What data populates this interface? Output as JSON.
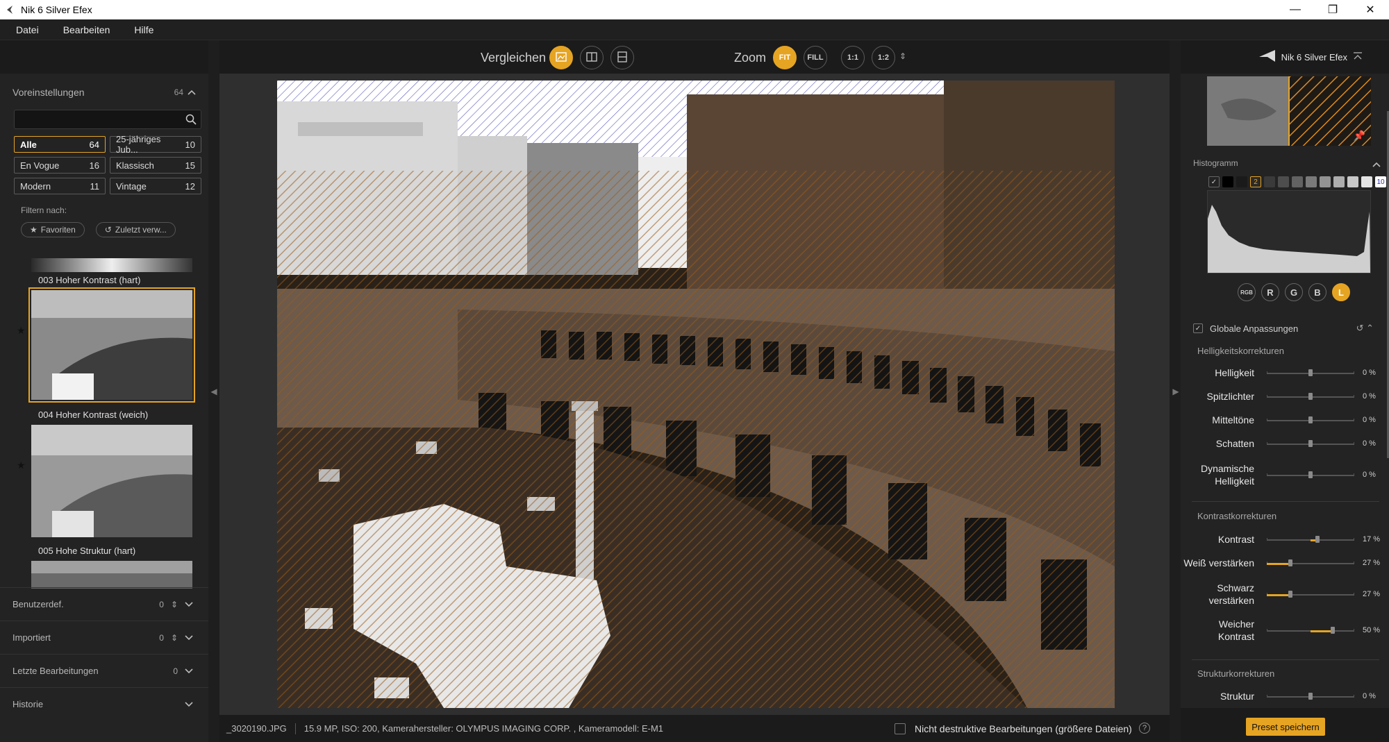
{
  "window": {
    "title": "Nik 6 Silver Efex",
    "minimize": "—",
    "restore": "❐",
    "close": "✕"
  },
  "menu": [
    "Datei",
    "Bearbeiten",
    "Hilfe"
  ],
  "left": {
    "presets_title": "Voreinstellungen",
    "presets_count": "64",
    "search_placeholder": "",
    "filters": [
      {
        "label": "Alle",
        "count": "64"
      },
      {
        "label": "25-jähriges Jub...",
        "count": "10"
      },
      {
        "label": "En Vogue",
        "count": "16"
      },
      {
        "label": "Klassisch",
        "count": "15"
      },
      {
        "label": "Modern",
        "count": "11"
      },
      {
        "label": "Vintage",
        "count": "12"
      }
    ],
    "filter_by": "Filtern nach:",
    "favorites": "Favoriten",
    "recent": "Zuletzt verw...",
    "thumbs": [
      {
        "label": "003 Hoher Kontrast (hart)"
      },
      {
        "label": "004 Hoher Kontrast (weich)"
      },
      {
        "label": "005 Hohe Struktur (hart)"
      }
    ],
    "sections": [
      {
        "title": "Benutzerdef.",
        "count": "0"
      },
      {
        "title": "Importiert",
        "count": "0"
      },
      {
        "title": "Letzte Bearbeitungen",
        "count": "0"
      },
      {
        "title": "Historie",
        "count": ""
      }
    ]
  },
  "toolbar": {
    "compare": "Vergleichen",
    "zoom": "Zoom",
    "zoom_fit": "FIT",
    "zoom_fill": "FILL",
    "zoom_11": "1:1",
    "zoom_12": "1:2"
  },
  "status": {
    "filename": "_3020190.JPG",
    "info": "15.9 MP, ISO: 200, Kamerahersteller: OLYMPUS IMAGING CORP.  , Kameramodell: E-M1",
    "nondestructive": "Nicht destruktive Bearbeitungen (größere Dateien)",
    "help": "?"
  },
  "right": {
    "brand": "Nik 6 Silver Efex",
    "histogram_title": "Histogramm",
    "swatch_2": "2",
    "swatch_10": "10",
    "channels": [
      "RGB",
      "R",
      "G",
      "B",
      "L"
    ],
    "global_title": "Globale Anpassungen",
    "brightness_group": "Helligkeitskorrekturen",
    "contrast_group": "Kontrastkorrekturen",
    "structure_group": "Strukturkorrekturen",
    "adjustments": {
      "helligkeit": {
        "label": "Helligkeit",
        "value": "0 %",
        "level": 0
      },
      "spitzlichter": {
        "label": "Spitzlichter",
        "value": "0 %",
        "level": 0
      },
      "mitteltoene": {
        "label": "Mitteltöne",
        "value": "0 %",
        "level": 0
      },
      "schatten": {
        "label": "Schatten",
        "value": "0 %",
        "level": 0
      },
      "dyn_l1": "Dynamische",
      "dyn_l2": "Helligkeit",
      "dyn_value": "0 %",
      "kontrast": {
        "label": "Kontrast",
        "value": "17 %",
        "level": 17
      },
      "weiss": {
        "label": "Weiß verstärken",
        "value": "27 %",
        "level": 27
      },
      "schwarz_l1": "Schwarz",
      "schwarz_l2": "verstärken",
      "schwarz_value": "27 %",
      "weich_l1": "Weicher",
      "weich_l2": "Kontrast",
      "weich_value": "50 %",
      "struktur": {
        "label": "Struktur",
        "value": "0 %",
        "level": 0
      }
    },
    "save_preset": "Preset speichern"
  },
  "colors": {
    "accent": "#e6a423",
    "panel": "#232323",
    "toolbar": "#1b1b1b"
  }
}
